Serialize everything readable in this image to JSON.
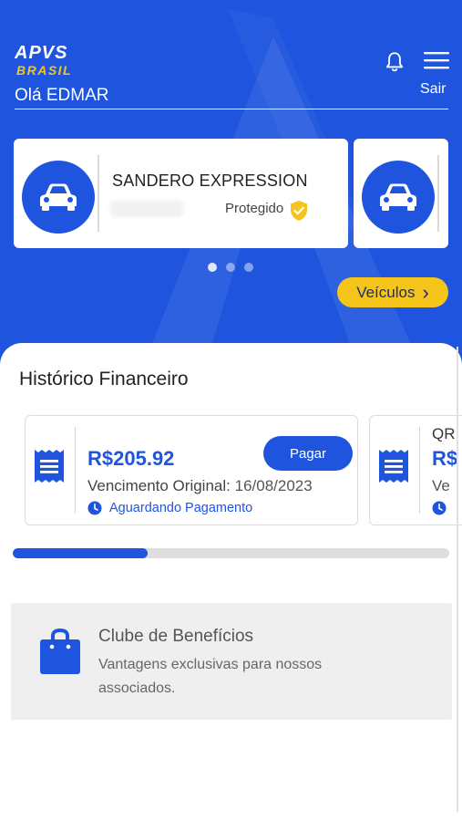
{
  "brand": {
    "line1": "APVS",
    "line2": "BRASIL"
  },
  "header": {
    "greeting": "Olá EDMAR",
    "logout_label": "Sair"
  },
  "vehicles": {
    "items": [
      {
        "name": "SANDERO EXPRESSION",
        "status": "Protegido"
      },
      {
        "name": "",
        "status": ""
      }
    ],
    "page_count": 3,
    "active_page": 0,
    "button_label": "Veículos",
    "button_chevron": "›"
  },
  "financial": {
    "title": "Histórico Financeiro",
    "items": [
      {
        "amount": "R$205.92",
        "due_label": "Vencimento Original:",
        "due_date": "16/08/2023",
        "status": "Aguardando Pagamento",
        "pay_label": "Pagar"
      },
      {
        "header": "QR",
        "amount": "R$",
        "due_label": "Ve",
        "status": ""
      }
    ],
    "scroll_progress": 0.31
  },
  "benefits": {
    "title": "Clube de Benefícios",
    "description": "Vantagens exclusivas para nossos associados."
  },
  "colors": {
    "primary": "#1f55de",
    "accent": "#f5c51b",
    "card_bg": "#ffffff",
    "panel_bg": "#efefef"
  },
  "icons": [
    "bell-icon",
    "menu-icon",
    "car-icon",
    "shield-check-icon",
    "chevron-right-icon",
    "receipt-icon",
    "clock-icon",
    "shopping-bag-icon"
  ]
}
